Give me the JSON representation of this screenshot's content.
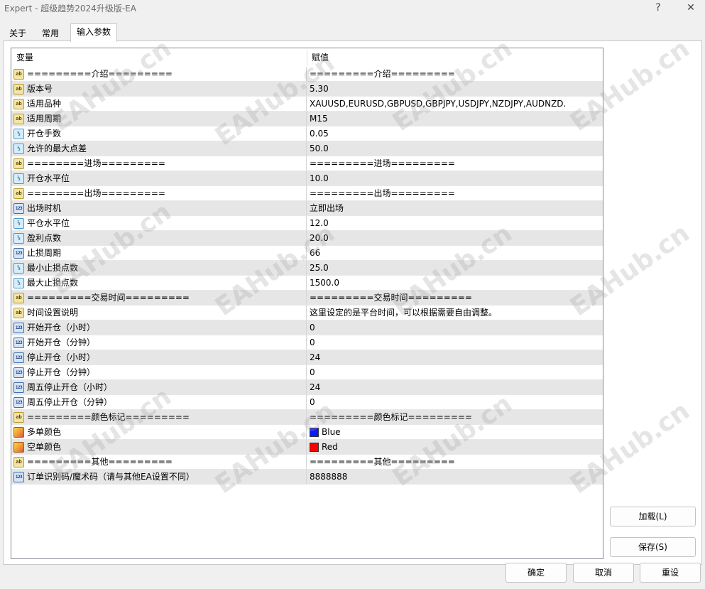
{
  "window": {
    "title": "Expert - 超级趋势2024升级版-EA",
    "help_label": "?",
    "close_label": "✕"
  },
  "tabs": [
    {
      "label": "关于"
    },
    {
      "label": "常用"
    },
    {
      "label": "输入参数"
    }
  ],
  "grid": {
    "header": {
      "variable": "变量",
      "value": "赋值"
    },
    "rows": [
      {
        "icon": "ab",
        "label": "=========介绍=========",
        "value": "=========介绍========="
      },
      {
        "icon": "ab",
        "label": "版本号",
        "value": "5.30"
      },
      {
        "icon": "ab",
        "label": "适用品种",
        "value": "XAUUSD,EURUSD,GBPUSD,GBPJPY,USDJPY,NZDJPY,AUDNZD..."
      },
      {
        "icon": "ab",
        "label": "适用周期",
        "value": "M15"
      },
      {
        "icon": "v2",
        "label": "开仓手数",
        "value": "0.05"
      },
      {
        "icon": "v2",
        "label": "允许的最大点差",
        "value": "50.0"
      },
      {
        "icon": "ab",
        "label": "========进场=========",
        "value": "=========进场========="
      },
      {
        "icon": "v2",
        "label": "开仓水平位",
        "value": "10.0"
      },
      {
        "icon": "ab",
        "label": "========出场=========",
        "value": "=========出场========="
      },
      {
        "icon": "123",
        "label": "出场时机",
        "value": "立即出场"
      },
      {
        "icon": "v2",
        "label": "平仓水平位",
        "value": "12.0"
      },
      {
        "icon": "v2",
        "label": "盈利点数",
        "value": "20.0"
      },
      {
        "icon": "123",
        "label": "止损周期",
        "value": "66"
      },
      {
        "icon": "v2",
        "label": "最小止损点数",
        "value": "25.0"
      },
      {
        "icon": "v2",
        "label": "最大止损点数",
        "value": "1500.0"
      },
      {
        "icon": "ab",
        "label": "=========交易时间=========",
        "value": "=========交易时间========="
      },
      {
        "icon": "ab",
        "label": "时间设置说明",
        "value": "这里设定的是平台时间，可以根据需要自由调整。"
      },
      {
        "icon": "123",
        "label": "开始开仓（小时）",
        "value": "0"
      },
      {
        "icon": "123",
        "label": "开始开仓（分钟）",
        "value": "0"
      },
      {
        "icon": "123",
        "label": "停止开仓（小时）",
        "value": "24"
      },
      {
        "icon": "123",
        "label": "停止开仓（分钟）",
        "value": "0"
      },
      {
        "icon": "123",
        "label": "周五停止开仓（小时）",
        "value": "24"
      },
      {
        "icon": "123",
        "label": "周五停止开仓（分钟）",
        "value": "0"
      },
      {
        "icon": "ab",
        "label": "=========颜色标记=========",
        "value": "=========颜色标记========="
      },
      {
        "icon": "color",
        "label": "多单颜色",
        "value": "Blue",
        "swatch": "#0a1aff"
      },
      {
        "icon": "color",
        "label": "空单颜色",
        "value": "Red",
        "swatch": "#ff0000"
      },
      {
        "icon": "ab",
        "label": "=========其他=========",
        "value": "=========其他========="
      },
      {
        "icon": "123",
        "label": "订单识别码/魔术码（请与其他EA设置不同）",
        "value": "8888888"
      }
    ]
  },
  "buttons": {
    "load": "加载(L)",
    "save": "保存(S)",
    "ok": "确定",
    "cancel": "取消",
    "reset": "重设"
  },
  "watermark_text": "EAHub.cn"
}
